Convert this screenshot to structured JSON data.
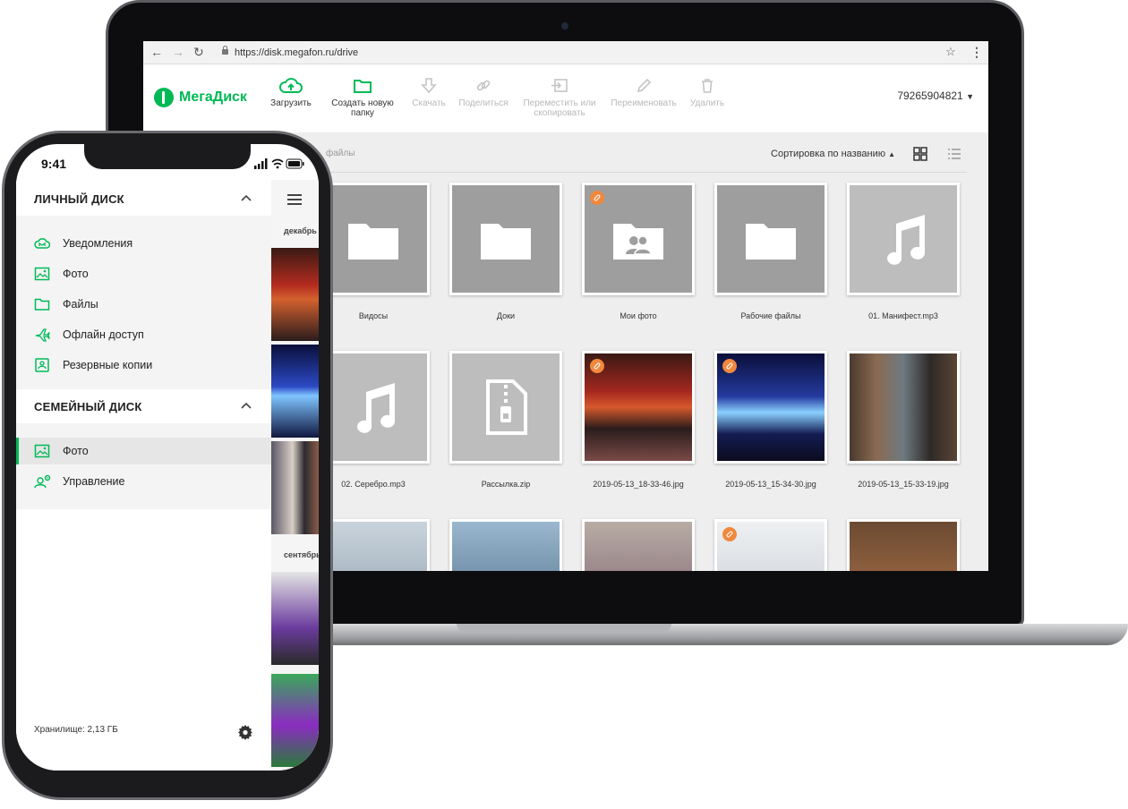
{
  "browser": {
    "url": "https://disk.megafon.ru/drive"
  },
  "app": {
    "logo": "МегаДиск",
    "user_phone": "79265904821"
  },
  "toolbar": [
    {
      "label": "Загрузить",
      "icon": "cloud-upload-icon",
      "enabled": true
    },
    {
      "label": "Создать новую папку",
      "icon": "folder-icon",
      "enabled": true
    },
    {
      "label": "Скачать",
      "icon": "download-icon",
      "enabled": false
    },
    {
      "label": "Поделиться",
      "icon": "link-icon",
      "enabled": false
    },
    {
      "label": "Переместить или скопировать",
      "icon": "move-icon",
      "enabled": false
    },
    {
      "label": "Переименовать",
      "icon": "pencil-icon",
      "enabled": false
    },
    {
      "label": "Удалить",
      "icon": "trash-icon",
      "enabled": false
    }
  ],
  "content": {
    "breadcrumb": "файлы",
    "sort_label": "Сортировка по названию"
  },
  "files": [
    {
      "name": "Видосы",
      "type": "folder"
    },
    {
      "name": "Доки",
      "type": "folder"
    },
    {
      "name": "Мои фото",
      "type": "shared-folder",
      "shared": true
    },
    {
      "name": "Рабочие файлы",
      "type": "folder"
    },
    {
      "name": "01. Манифест.mp3",
      "type": "audio"
    },
    {
      "name": "02. Серебро.mp3",
      "type": "audio"
    },
    {
      "name": "Рассылка.zip",
      "type": "zip"
    },
    {
      "name": "2019-05-13_18-33-46.jpg",
      "type": "photo",
      "shared": true
    },
    {
      "name": "2019-05-13_15-34-30.jpg",
      "type": "photo",
      "shared": true
    },
    {
      "name": "2019-05-13_15-33-19.jpg",
      "type": "photo"
    }
  ],
  "phone": {
    "time": "9:41",
    "sections": [
      {
        "title": "ЛИЧНЫЙ ДИСК",
        "items": [
          "Уведомления",
          "Фото",
          "Файлы",
          "Офлайн доступ",
          "Резервные копии"
        ]
      },
      {
        "title": "СЕМЕЙНЫЙ ДИСК",
        "items": [
          "Фото",
          "Управление"
        ]
      }
    ],
    "storage": "Хранилище: 2,13 ГБ",
    "months": [
      "декабрь",
      "сентябрь"
    ]
  },
  "colors": {
    "brand": "#00b956",
    "badge": "#f0883e"
  }
}
